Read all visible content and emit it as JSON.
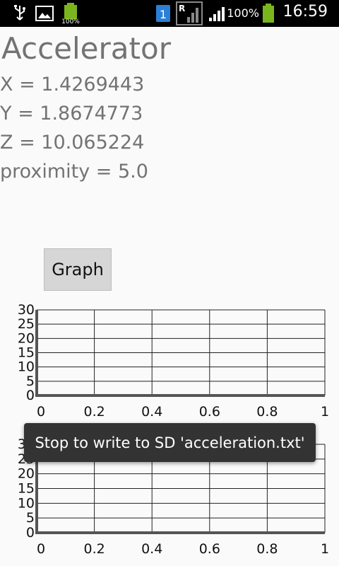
{
  "status_bar": {
    "battery_small_label": "100%",
    "notification_count": "1",
    "roaming_label": "R",
    "battery_percent": "100%",
    "time": "16:59"
  },
  "app": {
    "title": "Accelerator",
    "readings": [
      "X = 1.4269443",
      "Y = 1.8674773",
      "Z = 10.065224",
      "proximity = 5.0"
    ],
    "graph_button": "Graph"
  },
  "chart_data": [
    {
      "type": "line",
      "x_ticks": [
        "0",
        "0.2",
        "0.4",
        "0.6",
        "0.8",
        "1"
      ],
      "y_ticks": [
        "0",
        "5",
        "10",
        "15",
        "20",
        "25",
        "30"
      ],
      "xlim": [
        0,
        1
      ],
      "ylim": [
        0,
        30
      ],
      "grid": true,
      "series": []
    },
    {
      "type": "line",
      "x_ticks": [
        "0",
        "0.2",
        "0.4",
        "0.6",
        "0.8",
        "1"
      ],
      "y_ticks": [
        "0",
        "5",
        "10",
        "15",
        "20",
        "25",
        "30"
      ],
      "xlim": [
        0,
        1
      ],
      "ylim": [
        0,
        30
      ],
      "grid": true,
      "series": []
    }
  ],
  "toast": {
    "message": "Stop to write to SD 'acceleration.txt'"
  }
}
